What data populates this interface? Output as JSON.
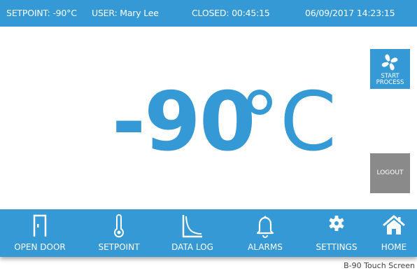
{
  "status_bar": {
    "setpoint": "SETPOINT:  -90°C",
    "user": "USER:  Mary Lee",
    "closed": "CLOSED:  00:45:15",
    "datetime": "06/09/2017 14:23:15"
  },
  "display": {
    "temperature_value": "-90",
    "temperature_unit": "°C"
  },
  "side_buttons": {
    "start_process": {
      "line1": "START",
      "line2": "PROCESS",
      "icon": "fan-icon"
    },
    "logout": {
      "label": "LOGOUT"
    }
  },
  "nav": {
    "items": [
      {
        "label": "OPEN DOOR",
        "icon": "door-icon"
      },
      {
        "label": "SETPOINT",
        "icon": "thermometer-icon"
      },
      {
        "label": "DATA LOG",
        "icon": "chart-curve-icon"
      },
      {
        "label": "ALARMS",
        "icon": "bell-icon"
      },
      {
        "label": "SETTINGS",
        "icon": "gear-icon"
      },
      {
        "label": "HOME",
        "icon": "home-icon"
      }
    ]
  },
  "caption": "B-90 Touch Screen",
  "colors": {
    "accent": "#3499d4",
    "logout_gray": "#8a8a8a",
    "background": "#ffffff"
  }
}
